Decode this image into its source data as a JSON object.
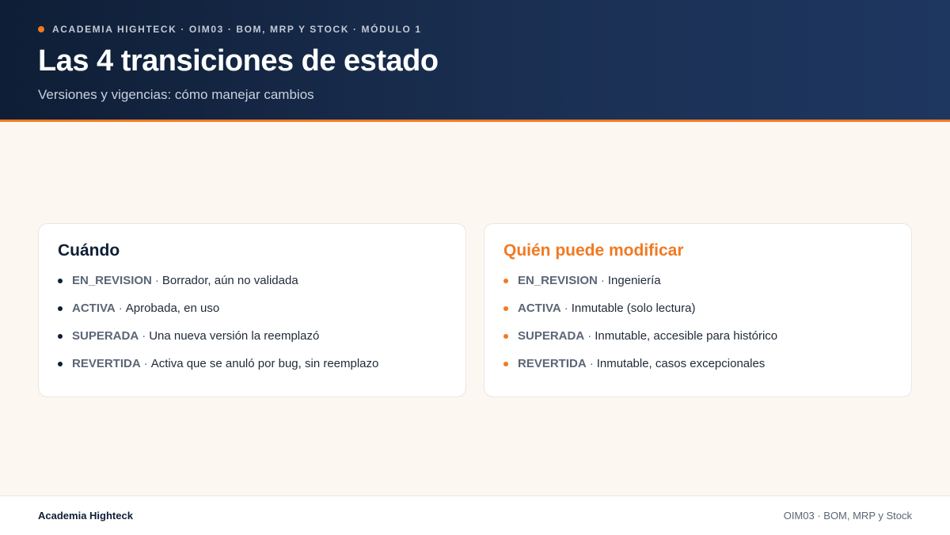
{
  "header": {
    "eyebrow": "ACADEMIA HIGHTECK · OIM03 · BOM, MRP Y STOCK · MÓDULO 1",
    "title": "Las 4 transiciones de estado",
    "subtitle": "Versiones y vigencias: cómo manejar cambios"
  },
  "cards": [
    {
      "heading": "Cuándo",
      "items": [
        {
          "state": "EN_REVISION",
          "text": "Borrador, aún no validada"
        },
        {
          "state": "ACTIVA",
          "text": "Aprobada, en uso"
        },
        {
          "state": "SUPERADA",
          "text": "Una nueva versión la reemplazó"
        },
        {
          "state": "REVERTIDA",
          "text": "Activa que se anuló por bug, sin reemplazo"
        }
      ]
    },
    {
      "heading": "Quién puede modificar",
      "items": [
        {
          "state": "EN_REVISION",
          "text": "Ingeniería"
        },
        {
          "state": "ACTIVA",
          "text": "Inmutable (solo lectura)"
        },
        {
          "state": "SUPERADA",
          "text": "Inmutable, accesible para histórico"
        },
        {
          "state": "REVERTIDA",
          "text": "Inmutable, casos excepcionales"
        }
      ]
    }
  ],
  "footer": {
    "left": "Academia Highteck",
    "right": "OIM03 · BOM, MRP y Stock"
  },
  "colors": {
    "accent": "#f07a22",
    "navy": "#0f1e36",
    "background": "#fdf7f2"
  }
}
